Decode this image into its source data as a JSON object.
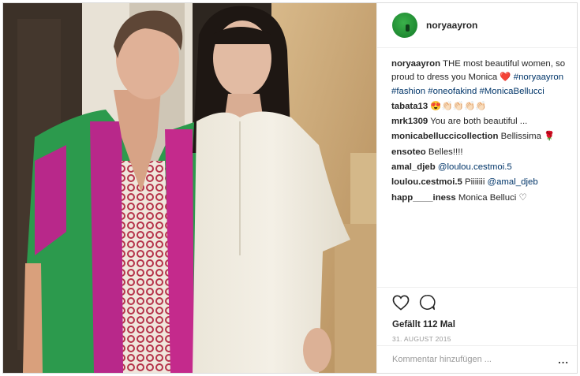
{
  "post": {
    "username": "noryaayron",
    "caption": {
      "user": "noryaayron",
      "text": "THE most beautiful women, so proud to dress you Monica",
      "emoji": "❤️",
      "hashtags": "#noryaayron #fashion #oneofakind #MonicaBellucci"
    },
    "comments": [
      {
        "user": "tabata13",
        "text": "😍👏🏻👏🏻👏🏻👏🏻"
      },
      {
        "user": "mrk1309",
        "text": "You are both beautiful ..."
      },
      {
        "user": "monicabelluccicollection",
        "text": "Bellissima 🌹"
      },
      {
        "user": "ensoteo",
        "text": "Belles!!!!"
      },
      {
        "user": "amal_djeb",
        "text": "@loulou.cestmoi.5"
      },
      {
        "user": "loulou.cestmoi.5",
        "text": "Piiiiiii",
        "mention": "@amal_djeb"
      },
      {
        "user": "happ____iness",
        "text": "Monica Belluci ♡"
      }
    ],
    "likes_label": "Gefällt 112 Mal",
    "date": "31. AUGUST 2015",
    "add_comment_placeholder": "Kommentar hinzufügen ...",
    "more_label": "..."
  },
  "icons": {
    "like": "heart-outline-icon",
    "comment": "comment-bubble-icon"
  },
  "colors": {
    "hashtag": "#003569",
    "muted": "#999999",
    "text": "#262626"
  }
}
